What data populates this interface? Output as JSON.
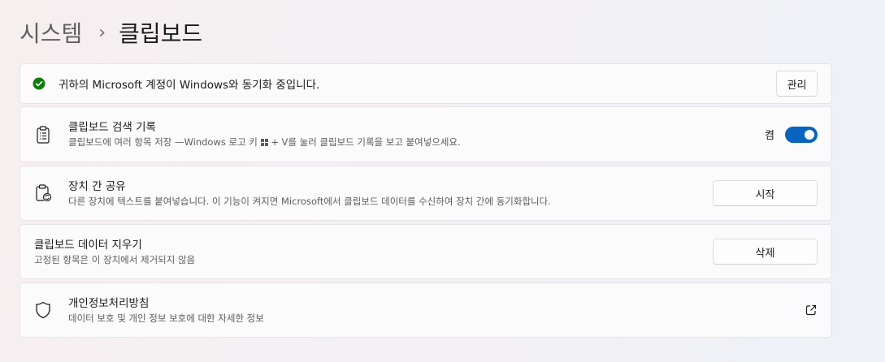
{
  "breadcrumb": {
    "parent": "시스템",
    "separator": "›",
    "current": "클립보드"
  },
  "sync": {
    "text": "귀하의 Microsoft 계정이 Windows와 동기화 중입니다.",
    "button": "관리",
    "status_color": "#107c10"
  },
  "history": {
    "title": "클립보드 검색 기록",
    "desc_before": "클립보드에 여러 항목 저장 —Windows 로고 키 ",
    "desc_after": " + V를 눌러 클립보드 기록을 보고 붙여넣으세요.",
    "toggle_label": "켬",
    "toggle_on": true
  },
  "share": {
    "title": "장치 간 공유",
    "desc": "다른 장치에 텍스트를 붙여넣습니다. 이 기능이 켜지면 Microsoft에서 클립보드 데이터를 수신하여 장치 간에 동기화합니다.",
    "button": "시작"
  },
  "clear": {
    "title": "클립보드 데이터 지우기",
    "desc": "고정된 항목은 이 장치에서 제거되지 않음",
    "button": "삭제"
  },
  "privacy": {
    "title": "개인정보처리방침",
    "desc": "데이터 보호 및 개인 정보 보호에 대한 자세한 정보"
  },
  "colors": {
    "accent": "#0a63bf",
    "success": "#107c10"
  },
  "icons": {
    "sync": "check-circle-icon",
    "history": "clipboard-list-icon",
    "share": "clipboard-sync-icon",
    "privacy": "shield-icon",
    "external": "open-external-icon",
    "windows": "windows-logo-icon"
  }
}
